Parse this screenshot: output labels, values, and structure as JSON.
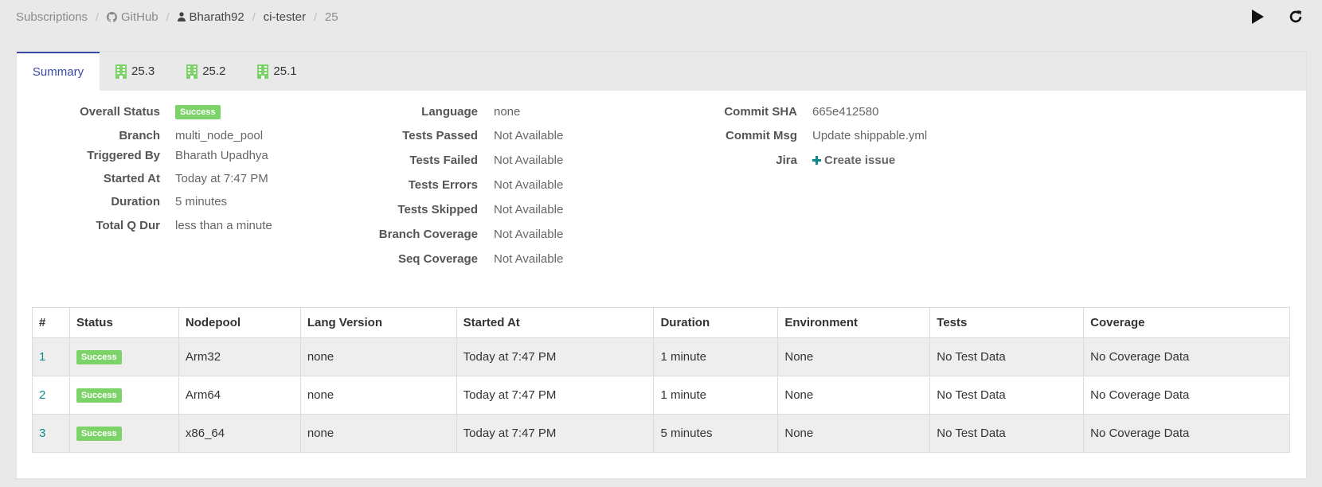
{
  "breadcrumb": {
    "subscriptions": "Subscriptions",
    "provider": "GitHub",
    "owner": "Bharath92",
    "repo": "ci-tester",
    "build": "25"
  },
  "actions": {
    "run_icon": "play-icon",
    "refresh_icon": "refresh-icon"
  },
  "tabs": [
    {
      "label": "Summary",
      "active": true
    },
    {
      "label": "25.3",
      "icon": "building-icon"
    },
    {
      "label": "25.2",
      "icon": "building-icon"
    },
    {
      "label": "25.1",
      "icon": "building-icon"
    }
  ],
  "summary": {
    "overall_status_label": "Overall Status",
    "overall_status_value": "Success",
    "branch_label": "Branch",
    "branch_value": "multi_node_pool",
    "triggered_by_label": "Triggered By",
    "triggered_by_value": "Bharath Upadhya",
    "started_at_label": "Started At",
    "started_at_value": "Today at 7:47 PM",
    "duration_label": "Duration",
    "duration_value": "5 minutes",
    "total_q_dur_label": "Total Q Dur",
    "total_q_dur_value": "less than a minute",
    "language_label": "Language",
    "language_value": "none",
    "tests_passed_label": "Tests Passed",
    "tests_passed_value": "Not Available",
    "tests_failed_label": "Tests Failed",
    "tests_failed_value": "Not Available",
    "tests_errors_label": "Tests Errors",
    "tests_errors_value": "Not Available",
    "tests_skipped_label": "Tests Skipped",
    "tests_skipped_value": "Not Available",
    "branch_coverage_label": "Branch Coverage",
    "branch_coverage_value": "Not Available",
    "seq_coverage_label": "Seq Coverage",
    "seq_coverage_value": "Not Available",
    "commit_sha_label": "Commit SHA",
    "commit_sha_value": "665e412580",
    "commit_msg_label": "Commit Msg",
    "commit_msg_value": "Update shippable.yml",
    "jira_label": "Jira",
    "jira_action": "Create issue"
  },
  "table": {
    "headers": [
      "#",
      "Status",
      "Nodepool",
      "Lang Version",
      "Started At",
      "Duration",
      "Environment",
      "Tests",
      "Coverage"
    ],
    "rows": [
      {
        "num": "1",
        "status": "Success",
        "nodepool": "Arm32",
        "lang": "none",
        "started": "Today at 7:47 PM",
        "duration": "1 minute",
        "env": "None",
        "tests": "No Test Data",
        "coverage": "No Coverage Data"
      },
      {
        "num": "2",
        "status": "Success",
        "nodepool": "Arm64",
        "lang": "none",
        "started": "Today at 7:47 PM",
        "duration": "1 minute",
        "env": "None",
        "tests": "No Test Data",
        "coverage": "No Coverage Data"
      },
      {
        "num": "3",
        "status": "Success",
        "nodepool": "x86_64",
        "lang": "none",
        "started": "Today at 7:47 PM",
        "duration": "5 minutes",
        "env": "None",
        "tests": "No Test Data",
        "coverage": "No Coverage Data"
      }
    ]
  },
  "colors": {
    "accent": "#3a4aa8",
    "link": "#0f8a8a",
    "success": "#7bd36a"
  }
}
